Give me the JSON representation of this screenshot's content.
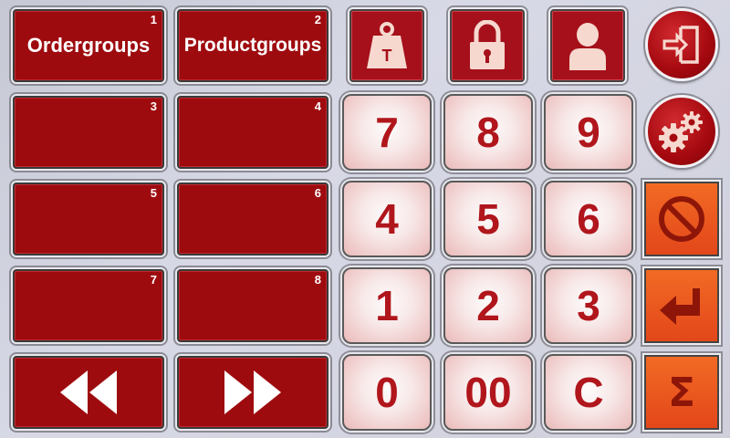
{
  "groups": [
    {
      "label": "Ordergroups",
      "num": "1"
    },
    {
      "label": "Productgroups",
      "num": "2"
    },
    {
      "label": "",
      "num": "3"
    },
    {
      "label": "",
      "num": "4"
    },
    {
      "label": "",
      "num": "5"
    },
    {
      "label": "",
      "num": "6"
    },
    {
      "label": "",
      "num": "7"
    },
    {
      "label": "",
      "num": "8"
    }
  ],
  "nav": {
    "prev_icon": "double-left-arrow-icon",
    "next_icon": "double-right-arrow-icon"
  },
  "top_icons": {
    "weight_label": "T",
    "icons": [
      "weight-tare-icon",
      "padlock-icon",
      "user-icon",
      "exit-door-icon",
      "settings-gears-icon"
    ]
  },
  "keypad": {
    "row1": [
      "7",
      "8",
      "9"
    ],
    "row2": [
      "4",
      "5",
      "6"
    ],
    "row3": [
      "1",
      "2",
      "3"
    ],
    "row4": [
      "0",
      "00",
      "C"
    ]
  },
  "actions": {
    "cancel_icon": "no-entry-icon",
    "enter_icon": "enter-return-icon",
    "sum_label": "Σ"
  },
  "colors": {
    "group_red": "#9e0b0f",
    "key_text": "#b0161c",
    "action_orange": "#e3471a"
  }
}
